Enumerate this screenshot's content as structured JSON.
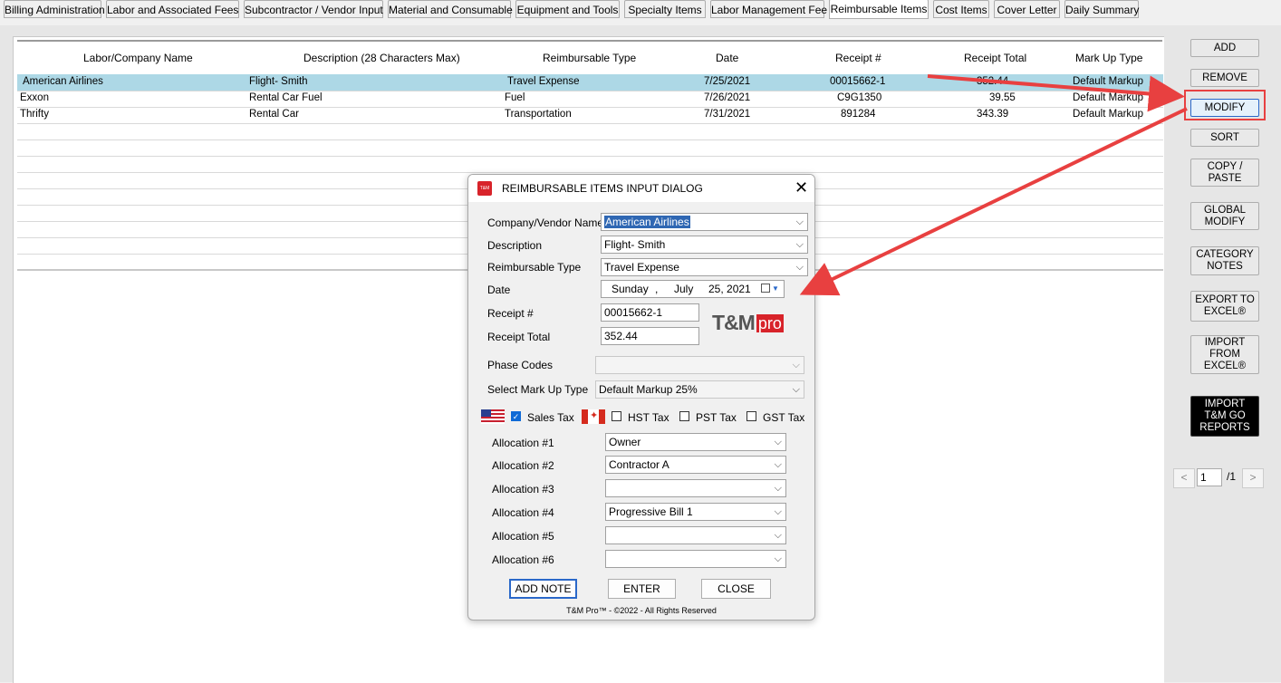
{
  "tabs": [
    "Billing Administration",
    "Labor and Associated Fees",
    "Subcontractor / Vendor Input",
    "Material and Consumable",
    "Equipment and Tools",
    "Specialty Items",
    "Labor Management Fee",
    "Reimbursable Items",
    "Cost Items",
    "Cover Letter",
    "Daily Summary"
  ],
  "active_tab": "Reimbursable Items",
  "grid": {
    "columns": [
      "Labor/Company Name",
      "Description (28 Characters Max)",
      "Reimbursable Type",
      "Date",
      "Receipt #",
      "Receipt Total",
      "Mark Up Type"
    ],
    "rows": [
      [
        "American Airlines",
        "Flight- Smith",
        "Travel Expense",
        "7/25/2021",
        "00015662-1",
        "352.44",
        "Default Markup"
      ],
      [
        "Exxon",
        "Rental Car Fuel",
        "Fuel",
        "7/26/2021",
        "C9G1350",
        "39.55",
        "Default Markup"
      ],
      [
        "Thrifty",
        "Rental Car",
        "Transportation",
        "7/31/2021",
        "891284",
        "343.39",
        "Default Markup"
      ]
    ]
  },
  "side_buttons": {
    "add": "ADD",
    "remove": "REMOVE",
    "modify": "MODIFY",
    "sort": "SORT",
    "copy_paste": [
      "COPY /",
      "PASTE"
    ],
    "global_modify": [
      "GLOBAL",
      "MODIFY"
    ],
    "category_notes": [
      "CATEGORY",
      "NOTES"
    ],
    "export_excel": [
      "EXPORT TO",
      "EXCEL®"
    ],
    "import_excel": [
      "IMPORT",
      "FROM",
      "EXCEL®"
    ],
    "import_go": [
      "IMPORT",
      "T&M GO",
      "REPORTS"
    ]
  },
  "pager": {
    "prev": "<",
    "current": "1",
    "total": "/1",
    "next": ">"
  },
  "dialog": {
    "title": "REIMBURSABLE ITEMS INPUT DIALOG",
    "logo_small": "T&M",
    "close": "✕",
    "labels": {
      "company": "Company/Vendor Name",
      "description": "Description",
      "type": "Reimbursable Type",
      "date": "Date",
      "receipt": "Receipt #",
      "total": "Receipt Total",
      "phase": "Phase Codes",
      "markup": "Select Mark Up Type"
    },
    "values": {
      "company": "American Airlines",
      "description": "Flight- Smith",
      "type": "Travel Expense",
      "date_day": "Sunday",
      "date_sep": ",",
      "date_month": "July",
      "date_rest": "25, 2021",
      "receipt": "00015662-1",
      "total": "352.44",
      "phase": "",
      "markup": "Default Markup 25%"
    },
    "brand": {
      "tm": "T&M",
      "pro": "pro"
    },
    "taxes": {
      "sales": {
        "label": "Sales Tax",
        "checked": true
      },
      "hst": {
        "label": "HST Tax",
        "checked": false
      },
      "pst": {
        "label": "PST Tax",
        "checked": false
      },
      "gst": {
        "label": "GST Tax",
        "checked": false
      }
    },
    "allocations": [
      {
        "label": "Allocation #1",
        "value": "Owner"
      },
      {
        "label": "Allocation #2",
        "value": "Contractor A"
      },
      {
        "label": "Allocation #3",
        "value": ""
      },
      {
        "label": "Allocation #4",
        "value": "Progressive Bill 1"
      },
      {
        "label": "Allocation #5",
        "value": ""
      },
      {
        "label": "Allocation #6",
        "value": ""
      }
    ],
    "buttons": {
      "add_note": "ADD NOTE",
      "enter": "ENTER",
      "close": "CLOSE"
    },
    "footer": "T&M Pro™ - ©2022 - All Rights Reserved"
  },
  "colors": {
    "selected_row": "#add8e6",
    "annotation": "#e84040",
    "brand_red": "#d8232a"
  }
}
